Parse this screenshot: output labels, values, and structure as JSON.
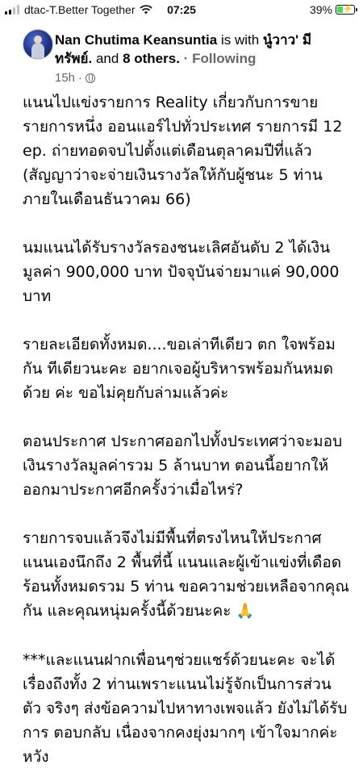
{
  "status_bar": {
    "carrier": "dtac-T.Better Together",
    "time": "07:25",
    "battery_percent": "39%",
    "battery_level": 0.39,
    "signal_bars": 4,
    "signal_bars_filled": 2,
    "accent_color": "#4cd964"
  },
  "post": {
    "author": "Nan Chutima Keansuntia",
    "with_text": "is with",
    "tagged": "นู๋วาว' มีทรัพย์.",
    "and_text": "and",
    "others": "8 others.",
    "separator": "·",
    "follow_label": "Following",
    "time_ago": "15h",
    "audience_icon": "globe-icon",
    "paragraphs": [
      "แนนไปแข่งรายการ Reality เกี่ยวกับการขาย รายการหนึ่ง ออนแอร์ไปทั่วประเทศ รายการมี 12 ep. ถ่ายทอดจบไปตั้งแต่เดือนตุลาคมปีที่แล้ว (สัญญาว่าจะจ่ายเงินรางวัลให้กับผู้ชนะ 5 ท่าน ภายในเดือนธันวาคม 66)",
      "นมแนนได้รับรางวัลรองชนะเลิศอันดับ 2 ได้เงิน มูลค่า 900,000 บาท ปัจจุบันจ่ายมาแค่ 90,000 บาท",
      "รายละเอียดทั้งหมด....ขอเล่าทีเดียว ตก ใจพร้อมกัน ทีเดียวนะคะ อยากเจอผู้บริหารพร้อมกันหมดด้วย ค่ะ ขอไม่คุยกับล่ามแล้วค่ะ",
      "ตอนประกาศ ประกาศออกไปทั้งประเทศว่าจะมอบ เงินรางวัลมูลค่ารวม 5 ล้านบาท ตอนนี้อยากให้ ออกมาประกาศอีกครั้งว่าเมื่อไหร่?",
      "รายการจบแล้วจึงไม่มีพื้นที่ตรงไหนให้ประกาศ แนนเองนึกถึง 2 พื้นที่นี้ แนนและผู้เข้าแข่งที่เดือด ร้อนทั้งหมดรวม 5 ท่าน ขอความช่วยเหลือจากคุณ กัน และคุณหนุ่มครั้งนี้ด้วยนะคะ",
      "***และแนนฝากเพื่อนๆช่วยแชร์ด้วยนะคะ จะได้ เรื่องถึงทั้ง 2 ท่านเพราะแนนไม่รู้จักเป็นการส่วนตัว จริงๆ ส่งข้อความไปหาทางเพจแล้ว ยังไม่ได้รับการ ตอบกลับ เนื่องจากคงยุ่งมากๆ เข้าใจมากค่ะ หวัง"
    ],
    "emoji": "🙏"
  }
}
